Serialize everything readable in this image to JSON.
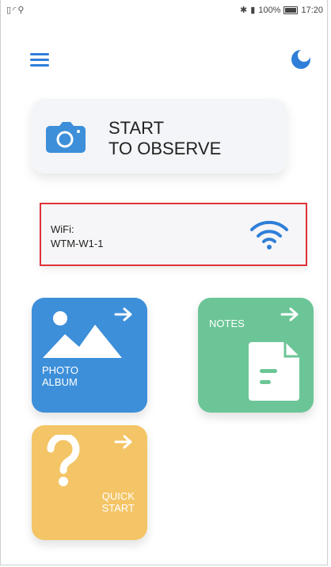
{
  "status_bar": {
    "left_icons": "sim-icon wifi-icon usb-icon",
    "battery_percent": "100%",
    "time": "17:20"
  },
  "header": {
    "menu_icon": "hamburger-menu-icon",
    "theme_icon": "moon-icon"
  },
  "observe": {
    "line1": "START",
    "line2": "TO OBSERVE"
  },
  "wifi": {
    "label": "WiFi:",
    "ssid": "WTM-W1-1"
  },
  "tiles": {
    "photo_album": {
      "line1": "PHOTO",
      "line2": "ALBUM"
    },
    "notes": {
      "label": "NOTES"
    },
    "quick_start": {
      "line1": "QUICK",
      "line2": "START"
    }
  },
  "colors": {
    "accent_blue": "#2f7fd8",
    "photo_tile": "#3d8fd9",
    "notes_tile": "#6cc597",
    "quick_tile": "#f4c566",
    "highlight_red": "#e0323a"
  }
}
